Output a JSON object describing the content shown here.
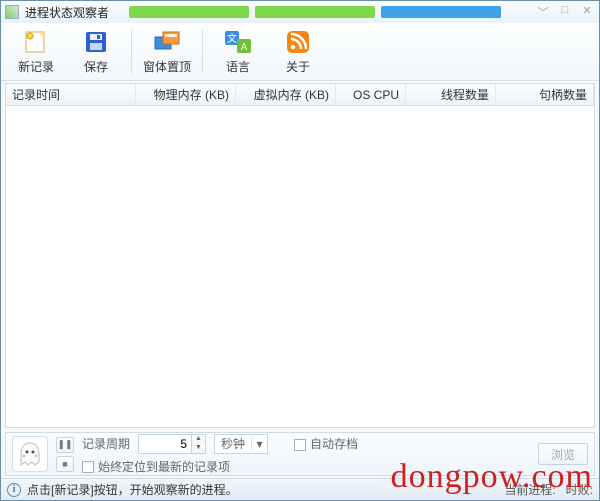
{
  "titlebar": {
    "title": "进程状态观察者"
  },
  "toolbar": {
    "new_record": "新记录",
    "save": "保存",
    "topmost": "窗体置顶",
    "language": "语言",
    "about": "关于"
  },
  "columns": {
    "time": "记录时间",
    "phys": "物理内存 (KB)",
    "virt": "虚拟内存 (KB)",
    "cpu": "OS CPU",
    "threads": "线程数量",
    "handles": "句柄数量"
  },
  "bottom": {
    "period_label": "记录周期",
    "period_value": "5",
    "unit_selected": "秒钟",
    "auto_archive_label": "自动存档",
    "pin_latest_label": "始终定位到最新的记录项",
    "browse_label": "浏览"
  },
  "status": {
    "hint": "点击[新记录]按钮，开始观察新的进程。",
    "right1": "当前进程:",
    "right2": "时败:"
  },
  "watermark": "dongpow.com",
  "icons": {
    "new_record": "new-record-icon",
    "save": "save-icon",
    "topmost": "topmost-icon",
    "language": "language-icon",
    "about": "rss-icon",
    "pause": "pause-icon",
    "stop": "stop-icon",
    "info": "info-icon"
  }
}
